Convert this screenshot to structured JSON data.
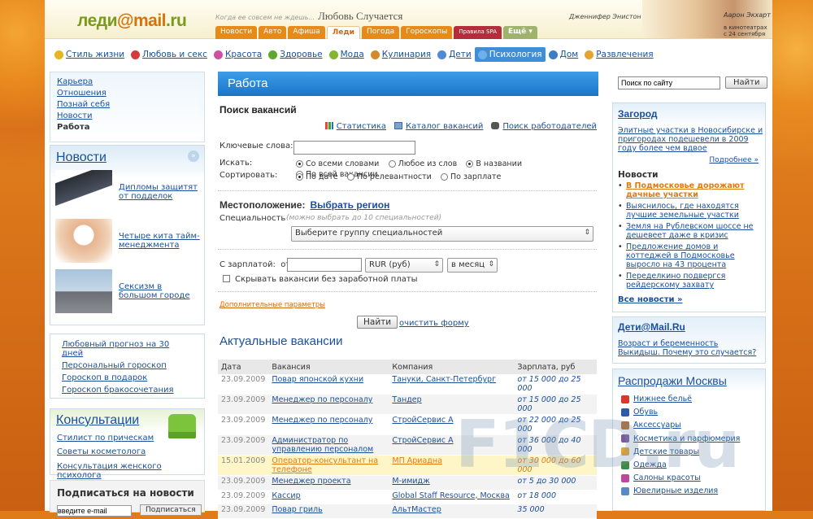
{
  "header": {
    "logo_main": "леди",
    "logo_at": "@mail",
    "logo_ru": ".ru",
    "tagline_small": "Когда ее совсем не ждешь...",
    "tagline_big": "Любовь Случается",
    "promo_left": "Дженнифер Энистон",
    "promo_right": "Аарон Экхарт",
    "promo_note": "в кинотеатрах с 24 сентября"
  },
  "portal_tabs": [
    {
      "label": "Новости"
    },
    {
      "label": "Авто"
    },
    {
      "label": "Афиша"
    },
    {
      "label": "Леди"
    },
    {
      "label": "Погода"
    },
    {
      "label": "Гороскопы"
    },
    {
      "label": "Правила SPA"
    },
    {
      "label": "Ещё ▾"
    }
  ],
  "nav": [
    {
      "label": "Стиль жизни",
      "color": "#e6b520"
    },
    {
      "label": "Любовь и секс",
      "color": "#d63b3b"
    },
    {
      "label": "Красота",
      "color": "#d04fa0"
    },
    {
      "label": "Здоровье",
      "color": "#5ca832"
    },
    {
      "label": "Мода",
      "color": "#84b52e"
    },
    {
      "label": "Кулинария",
      "color": "#d48a2a"
    },
    {
      "label": "Дети",
      "color": "#4f8ad6"
    },
    {
      "label": "Психология",
      "color": "#6fb0e8"
    },
    {
      "label": "Дом",
      "color": "#3a7ec4"
    },
    {
      "label": "Развлечения",
      "color": "#e5a431"
    }
  ],
  "left_nav": [
    "Карьера",
    "Отношения",
    "Познай себя",
    "Новости",
    "Работа"
  ],
  "news": {
    "title": "Новости",
    "items": [
      {
        "text": "Дипломы защитят от подделок"
      },
      {
        "text": "Четыре кита тайм-менеджмента"
      },
      {
        "text": "Сексизм в большом городе"
      }
    ]
  },
  "horo_links": [
    "Любовный прогноз на 30 дней",
    "Персональный гороскоп",
    "Гороскоп в подарок",
    "Гороскоп бракосочетания"
  ],
  "consult": {
    "title": "Консультации",
    "links": [
      "Стилист по прическам",
      "Советы косметолога",
      "Консультация женского психолога"
    ]
  },
  "subscribe": {
    "title": "Подписаться на новости",
    "placeholder": "введите e-mail",
    "button": "Подписаться"
  },
  "main": {
    "header": "Работа",
    "search_title": "Поиск вакансий",
    "top_links": [
      "Статистика",
      "Каталог вакансий",
      "Поиск работодателей"
    ],
    "kw_label": "Ключевые слова:",
    "search_label": "Искать:",
    "search_opts": [
      "Со всеми словами",
      "Любое из слов",
      "В названии",
      "По всей вакансии"
    ],
    "sort_label": "Сортировать:",
    "sort_opts": [
      "По дате",
      "По релевантности",
      "По зарплате"
    ],
    "loc_label": "Местоположение:",
    "loc_link": "Выбрать регион",
    "spec_label": "Специальность",
    "spec_hint": "(можно выбрать до 10 специальностей)",
    "spec_select": "Выберите группу специальностей",
    "salary_label": "С зарплатой:",
    "salary_from": "от",
    "currency": "RUR (руб)",
    "period": "в месяц",
    "hide_label": "Скрывать вакансии без заработной платы",
    "adv": "Дополнительные параметры",
    "find": "Найти",
    "clear": "очистить форму",
    "actual": "Актуальные вакансии",
    "cols": [
      "Дата",
      "Вакансия",
      "Компания",
      "Зарплата, руб"
    ],
    "rows": [
      {
        "date": "23.09.2009",
        "job": "Повар японской кухни",
        "company": "Тануки, Санкт-Петербург",
        "salary": "от 15 000 до 25 000"
      },
      {
        "date": "23.09.2009",
        "job": "Менеджер по персоналу",
        "company": "Тандер",
        "salary": "от 15 000 до 25 000"
      },
      {
        "date": "23.09.2009",
        "job": "Менеджер по персоналу",
        "company": "СтройСервис А",
        "salary": "от 22 000 до 25 000"
      },
      {
        "date": "23.09.2009",
        "job": "Администратор по управлению персоналом",
        "company": "СтройСервис А",
        "salary": "от 36 000 до 40 000"
      },
      {
        "date": "15.01.2009",
        "job": "Оператор-консультант на телефоне",
        "company": "МП Ариадна",
        "salary": "от 30 000 до 60 000"
      },
      {
        "date": "23.09.2009",
        "job": "Менеджер проекта",
        "company": "М-имидж",
        "salary": "от 5 до 30 000"
      },
      {
        "date": "23.09.2009",
        "job": "Кассир",
        "company": "Global Staff Resource, Москва",
        "salary": "от 18 000"
      },
      {
        "date": "23.09.2009",
        "job": "Повар гриль",
        "company": "АльтМастер",
        "salary": "35 000"
      }
    ]
  },
  "right": {
    "search_placeholder": "Поиск по сайту",
    "search_btn": "Найти",
    "zag_title": "Загород",
    "zag_lead": "Элитные участки в Новосибирске и пригородах подешевели в 2009 году более чем вдвое",
    "zag_more": "Подробнее »",
    "news_head": "Новости",
    "news": [
      "В Подмосковье дорожают дачные участки",
      "Выяснилось, где находятся лучшие земельные участки",
      "Земля на Рублевском шоссе не дешевеет даже в кризис",
      "Предложение домов и коттеджей в Подмосковье выросло на 43 процента",
      "Переделкино подвергся рейдерскому захвату"
    ],
    "all_news": "Все новости »",
    "deti_title": "Дети@Mail.Ru",
    "deti_link1": "Возраст и беременность",
    "deti_link2": "Выкидыш. Почему это случается?",
    "sales_title": "Распродажи Москвы",
    "sales": [
      {
        "label": "Нижнее бельё",
        "color": "#d8392c"
      },
      {
        "label": "Обувь",
        "color": "#2f5aa8"
      },
      {
        "label": "Аксессуары",
        "color": "#b86a2a"
      },
      {
        "label": "Косметика и парфюмерия",
        "color": "#7a5a9a"
      },
      {
        "label": "Детские товары",
        "color": "#e5a431"
      },
      {
        "label": "Одежда",
        "color": "#3e8a3e"
      },
      {
        "label": "Салоны красоты",
        "color": "#c0489a"
      },
      {
        "label": "Ювелирные изделия",
        "color": "#5a8ac4"
      }
    ]
  },
  "watermark": "F1CD.ru"
}
